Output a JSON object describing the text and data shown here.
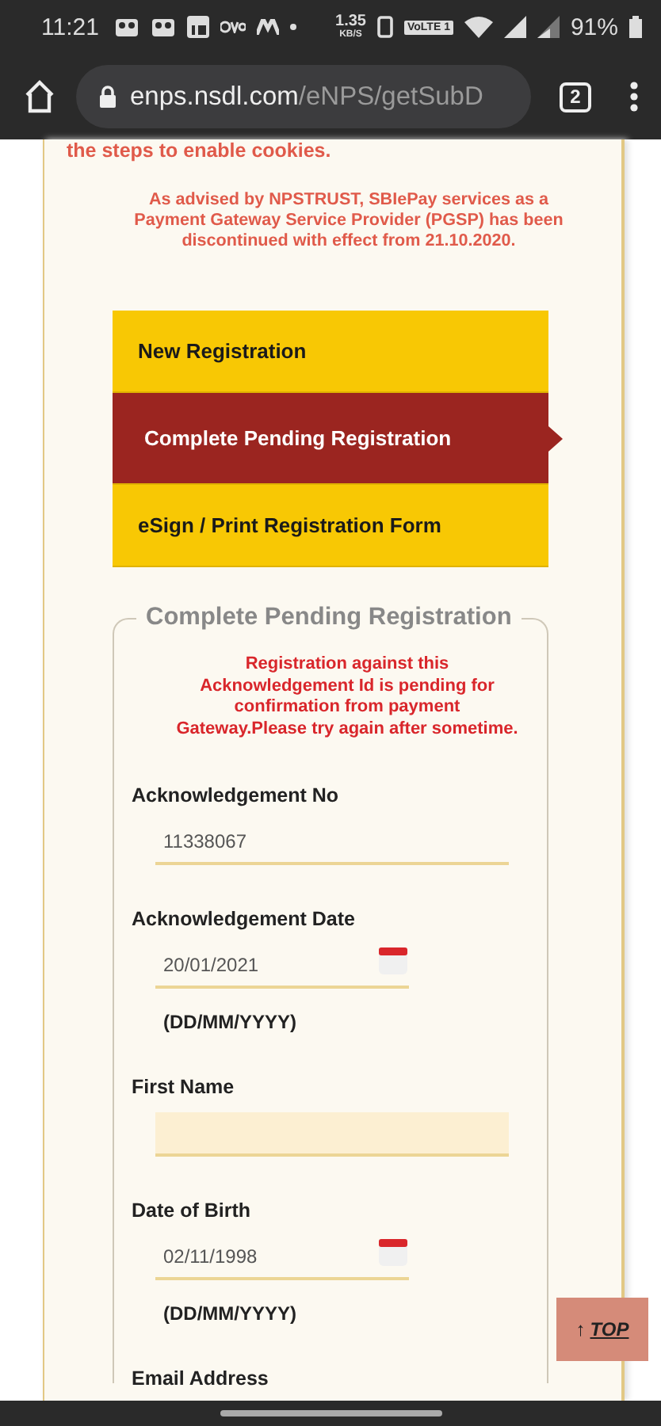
{
  "status_bar": {
    "time": "11:21",
    "speed_value": "1.35",
    "speed_unit": "KB/S",
    "network_badge": "VoLTE 1",
    "battery": "91%"
  },
  "browser": {
    "url_host": "enps.nsdl.com",
    "url_path": "/eNPS/getSubD",
    "tab_count": "2"
  },
  "cookie_notice": "the steps to enable cookies.",
  "advisory": "As advised by NPSTRUST, SBIePay services as a Payment Gateway Service Provider (PGSP) has been discontinued with effect from 21.10.2020.",
  "menu": [
    {
      "label": "New Registration",
      "selected": false
    },
    {
      "label": "Complete Pending Registration",
      "selected": true
    },
    {
      "label": "eSign / Print Registration Form",
      "selected": false
    }
  ],
  "form": {
    "legend": "Complete Pending Registration",
    "error": "Registration against this Acknowledgement Id is pending for confirmation from payment Gateway.Please try again after sometime.",
    "fields": [
      {
        "kind": "text",
        "label": "Acknowledgement No",
        "value": "11338067",
        "highlighted": false
      },
      {
        "kind": "date",
        "label": "Acknowledgement Date",
        "value": "20/01/2021",
        "format": "(DD/MM/YYYY)",
        "highlighted": false
      },
      {
        "kind": "text",
        "label": "First Name",
        "highlighted": true
      },
      {
        "kind": "date",
        "label": "Date of Birth",
        "value": "02/11/1998",
        "format": "(DD/MM/YYYY)",
        "highlighted": false
      },
      {
        "kind": "label",
        "label": "Email Address"
      }
    ]
  },
  "top_button": {
    "arrow": "↑",
    "label": "TOP"
  }
}
